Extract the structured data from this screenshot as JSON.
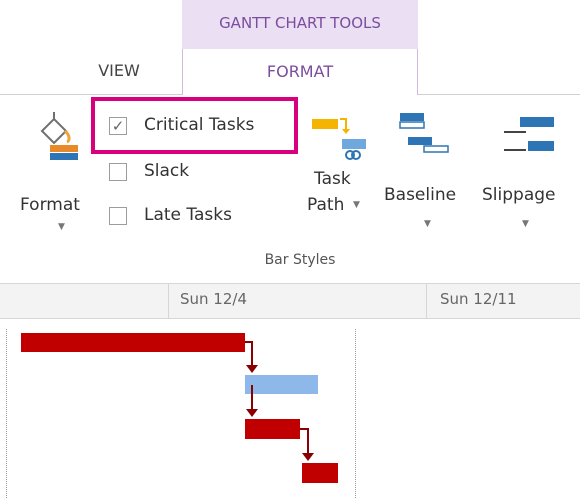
{
  "ribbon": {
    "contextual_group": "GANTT CHART TOOLS",
    "tabs": [
      {
        "label": "VIEW",
        "active": false
      },
      {
        "label": "FORMAT",
        "active": true
      }
    ],
    "format_button": {
      "label": "Format"
    },
    "checkboxes": [
      {
        "label": "Critical Tasks",
        "checked": true,
        "highlighted": true
      },
      {
        "label": "Slack",
        "checked": false
      },
      {
        "label": "Late Tasks",
        "checked": false
      }
    ],
    "task_path_button": {
      "label_line1": "Task",
      "label_line2": "Path"
    },
    "baseline_button": {
      "label": "Baseline"
    },
    "slippage_button": {
      "label": "Slippage"
    },
    "group_label": "Bar Styles"
  },
  "timescale": {
    "dates": [
      "Sun 12/4",
      "Sun 12/11"
    ]
  },
  "colors": {
    "critical_bar": "#c00000",
    "normal_bar": "#8fb8ea",
    "highlight": "#d9007e",
    "contextual_tab": "#eadff3"
  },
  "gantt_tasks": [
    {
      "critical": true
    },
    {
      "critical": false
    },
    {
      "critical": true
    },
    {
      "critical": true
    }
  ]
}
